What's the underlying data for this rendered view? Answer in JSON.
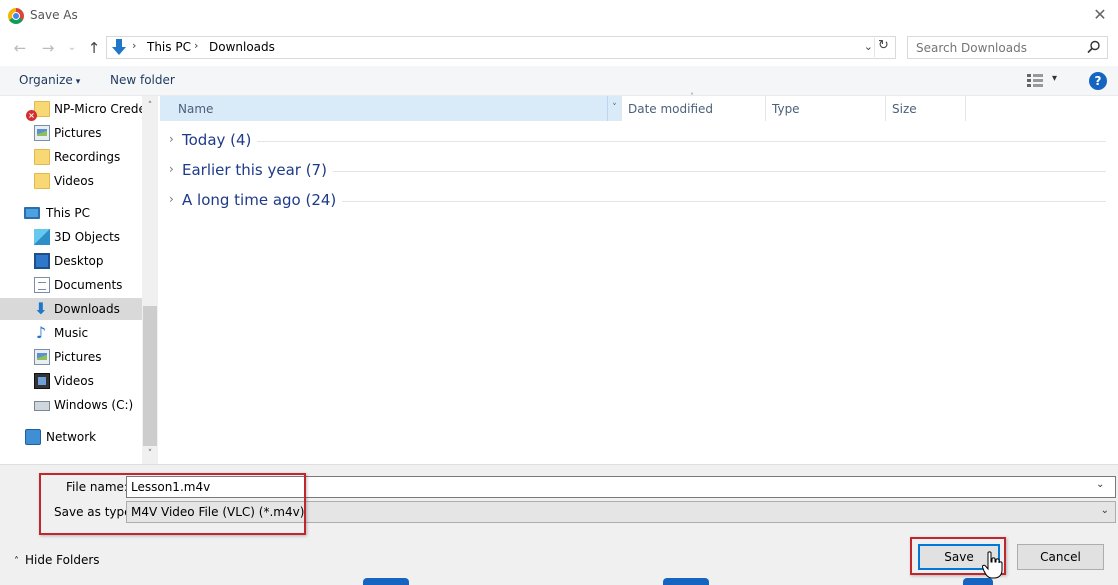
{
  "window": {
    "title": "Save As",
    "close_glyph": "✕",
    "app_icon": "chrome-icon"
  },
  "nav": {
    "back_glyph": "←",
    "forward_glyph": "→",
    "recent_glyph": "⌄",
    "up_glyph": "↑"
  },
  "address": {
    "crumbs": [
      "This PC",
      "Downloads"
    ],
    "separator": "›",
    "dropdown_glyph": "⌄",
    "refresh_glyph": "↻"
  },
  "search": {
    "placeholder": "Search Downloads"
  },
  "toolbar": {
    "organize_label": "Organize",
    "caret": "▾",
    "new_folder_label": "New folder",
    "help_label": "?"
  },
  "sidebar": {
    "items": [
      {
        "label": "NP-Micro Crede",
        "icon": "folder-icon",
        "error": true
      },
      {
        "label": "Pictures",
        "icon": "pictures-icon"
      },
      {
        "label": "Recordings",
        "icon": "folder-icon"
      },
      {
        "label": "Videos",
        "icon": "folder-icon"
      },
      {
        "label": "This PC",
        "icon": "this-pc-icon"
      },
      {
        "label": "3D Objects",
        "icon": "3d-objects-icon"
      },
      {
        "label": "Desktop",
        "icon": "desktop-icon"
      },
      {
        "label": "Documents",
        "icon": "documents-icon"
      },
      {
        "label": "Downloads",
        "icon": "downloads-icon",
        "selected": true
      },
      {
        "label": "Music",
        "icon": "music-icon"
      },
      {
        "label": "Pictures",
        "icon": "pictures-icon"
      },
      {
        "label": "Videos",
        "icon": "videos-icon"
      },
      {
        "label": "Windows (C:)",
        "icon": "drive-icon"
      },
      {
        "label": "Network",
        "icon": "network-icon"
      }
    ],
    "scroll_up": "˄",
    "scroll_down": "˅"
  },
  "filelist": {
    "columns": [
      "Name",
      "Date modified",
      "Type",
      "Size"
    ],
    "sort_glyph": "˄",
    "column_dd": "˅",
    "groups": [
      {
        "label": "Today (4)"
      },
      {
        "label": "Earlier this year (7)"
      },
      {
        "label": "A long time ago (24)"
      }
    ],
    "chevron": "›"
  },
  "form": {
    "filename_label": "File name:",
    "filename_value": "Lesson1.m4v",
    "filetype_label": "Save as type:",
    "filetype_value": "M4V Video File (VLC) (*.m4v)",
    "dropdown_glyph": "⌄",
    "hide_folders_label": "Hide Folders",
    "hide_chevron": "˄",
    "save_label": "Save",
    "cancel_label": "Cancel"
  },
  "colors": {
    "accent": "#0078d7",
    "highlight_red": "#c0262d",
    "group_text": "#1e3a8a",
    "selected_bg": "#d9d9d9"
  }
}
